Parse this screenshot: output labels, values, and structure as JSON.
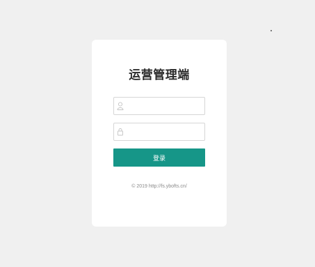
{
  "login": {
    "title": "运营管理端",
    "username": {
      "value": "",
      "placeholder": ""
    },
    "password": {
      "value": "",
      "placeholder": ""
    },
    "submit_label": "登录",
    "footer": "© 2019 http://fs.ybofts.cn/"
  },
  "colors": {
    "background": "#f0f0f0",
    "card": "#ffffff",
    "accent": "#169688"
  },
  "icons": {
    "username": "user-icon",
    "password": "lock-icon"
  }
}
